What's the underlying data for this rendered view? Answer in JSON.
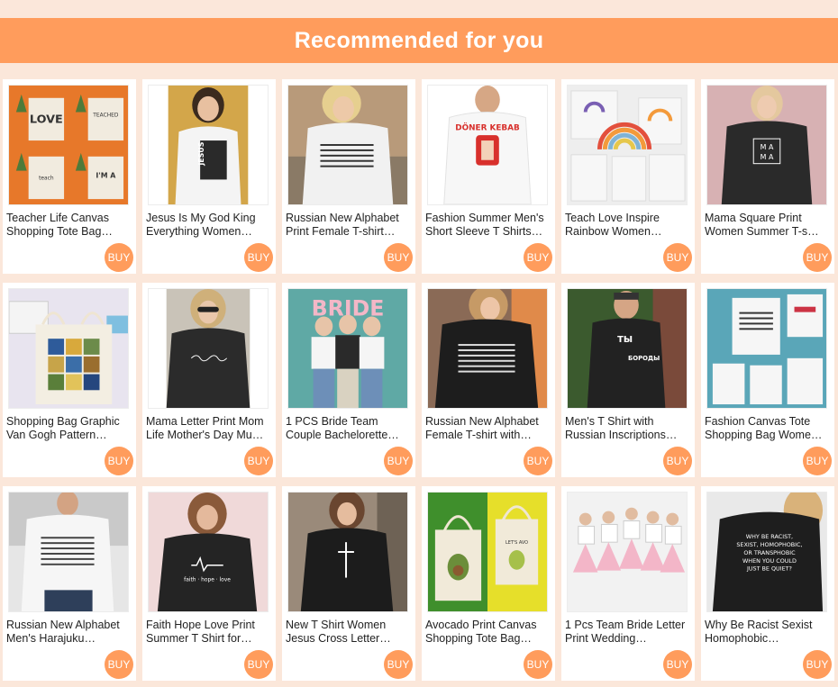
{
  "header": {
    "title": "Recommended for you"
  },
  "colors": {
    "accent": "#ff9c5c",
    "page_bg": "#fbe7da"
  },
  "products": [
    {
      "title": "Teacher Life Canvas Shopping Tote Bag…",
      "buy_label": "BUY",
      "image": "tote-bags-teacher-icon"
    },
    {
      "title": "Jesus Is My God King Everything Women…",
      "buy_label": "BUY",
      "image": "white-tshirt-jesus-icon"
    },
    {
      "title": "Russian New Alphabet Print Female T-shirt…",
      "buy_label": "BUY",
      "image": "white-tshirt-alphabet-icon"
    },
    {
      "title": "Fashion Summer Men's Short Sleeve T Shirts…",
      "buy_label": "BUY",
      "image": "white-tshirt-doner-icon"
    },
    {
      "title": "Teach Love Inspire Rainbow Women…",
      "buy_label": "BUY",
      "image": "tote-bags-rainbow-icon"
    },
    {
      "title": "Mama Square Print Women Summer T-s…",
      "buy_label": "BUY",
      "image": "black-tshirt-mama-icon"
    },
    {
      "title": "Shopping Bag Graphic Van Gogh Pattern…",
      "buy_label": "BUY",
      "image": "tote-bag-vangogh-icon"
    },
    {
      "title": "Mama Letter Print Mom Life Mother's Day Mu…",
      "buy_label": "BUY",
      "image": "black-tshirt-mama-script-icon"
    },
    {
      "title": "1 PCS Bride Team Couple Bachelorette…",
      "buy_label": "BUY",
      "image": "bride-team-shirts-icon"
    },
    {
      "title": "Russian New Alphabet Female T-shirt with…",
      "buy_label": "BUY",
      "image": "black-tshirt-alphabet-icon"
    },
    {
      "title": "Men's T Shirt with Russian Inscriptions…",
      "buy_label": "BUY",
      "image": "black-tshirt-men-russian-icon"
    },
    {
      "title": "Fashion Canvas Tote Shopping Bag Wome…",
      "buy_label": "BUY",
      "image": "tote-bags-text-icon"
    },
    {
      "title": "Russian New Alphabet Men's Harajuku…",
      "buy_label": "BUY",
      "image": "white-tshirt-men-alphabet-icon"
    },
    {
      "title": "Faith Hope Love Print Summer T Shirt for…",
      "buy_label": "BUY",
      "image": "black-tshirt-faith-icon"
    },
    {
      "title": "New T Shirt Women Jesus Cross Letter…",
      "buy_label": "BUY",
      "image": "black-tshirt-cross-icon"
    },
    {
      "title": "Avocado Print Canvas Shopping Tote Bag…",
      "buy_label": "BUY",
      "image": "tote-bag-avocado-icon"
    },
    {
      "title": "1 Pcs Team Bride Letter Print Wedding…",
      "buy_label": "BUY",
      "image": "team-bride-shirts-icon"
    },
    {
      "title": "Why Be Racist Sexist Homophobic…",
      "buy_label": "BUY",
      "image": "black-tshirt-text-icon"
    }
  ]
}
